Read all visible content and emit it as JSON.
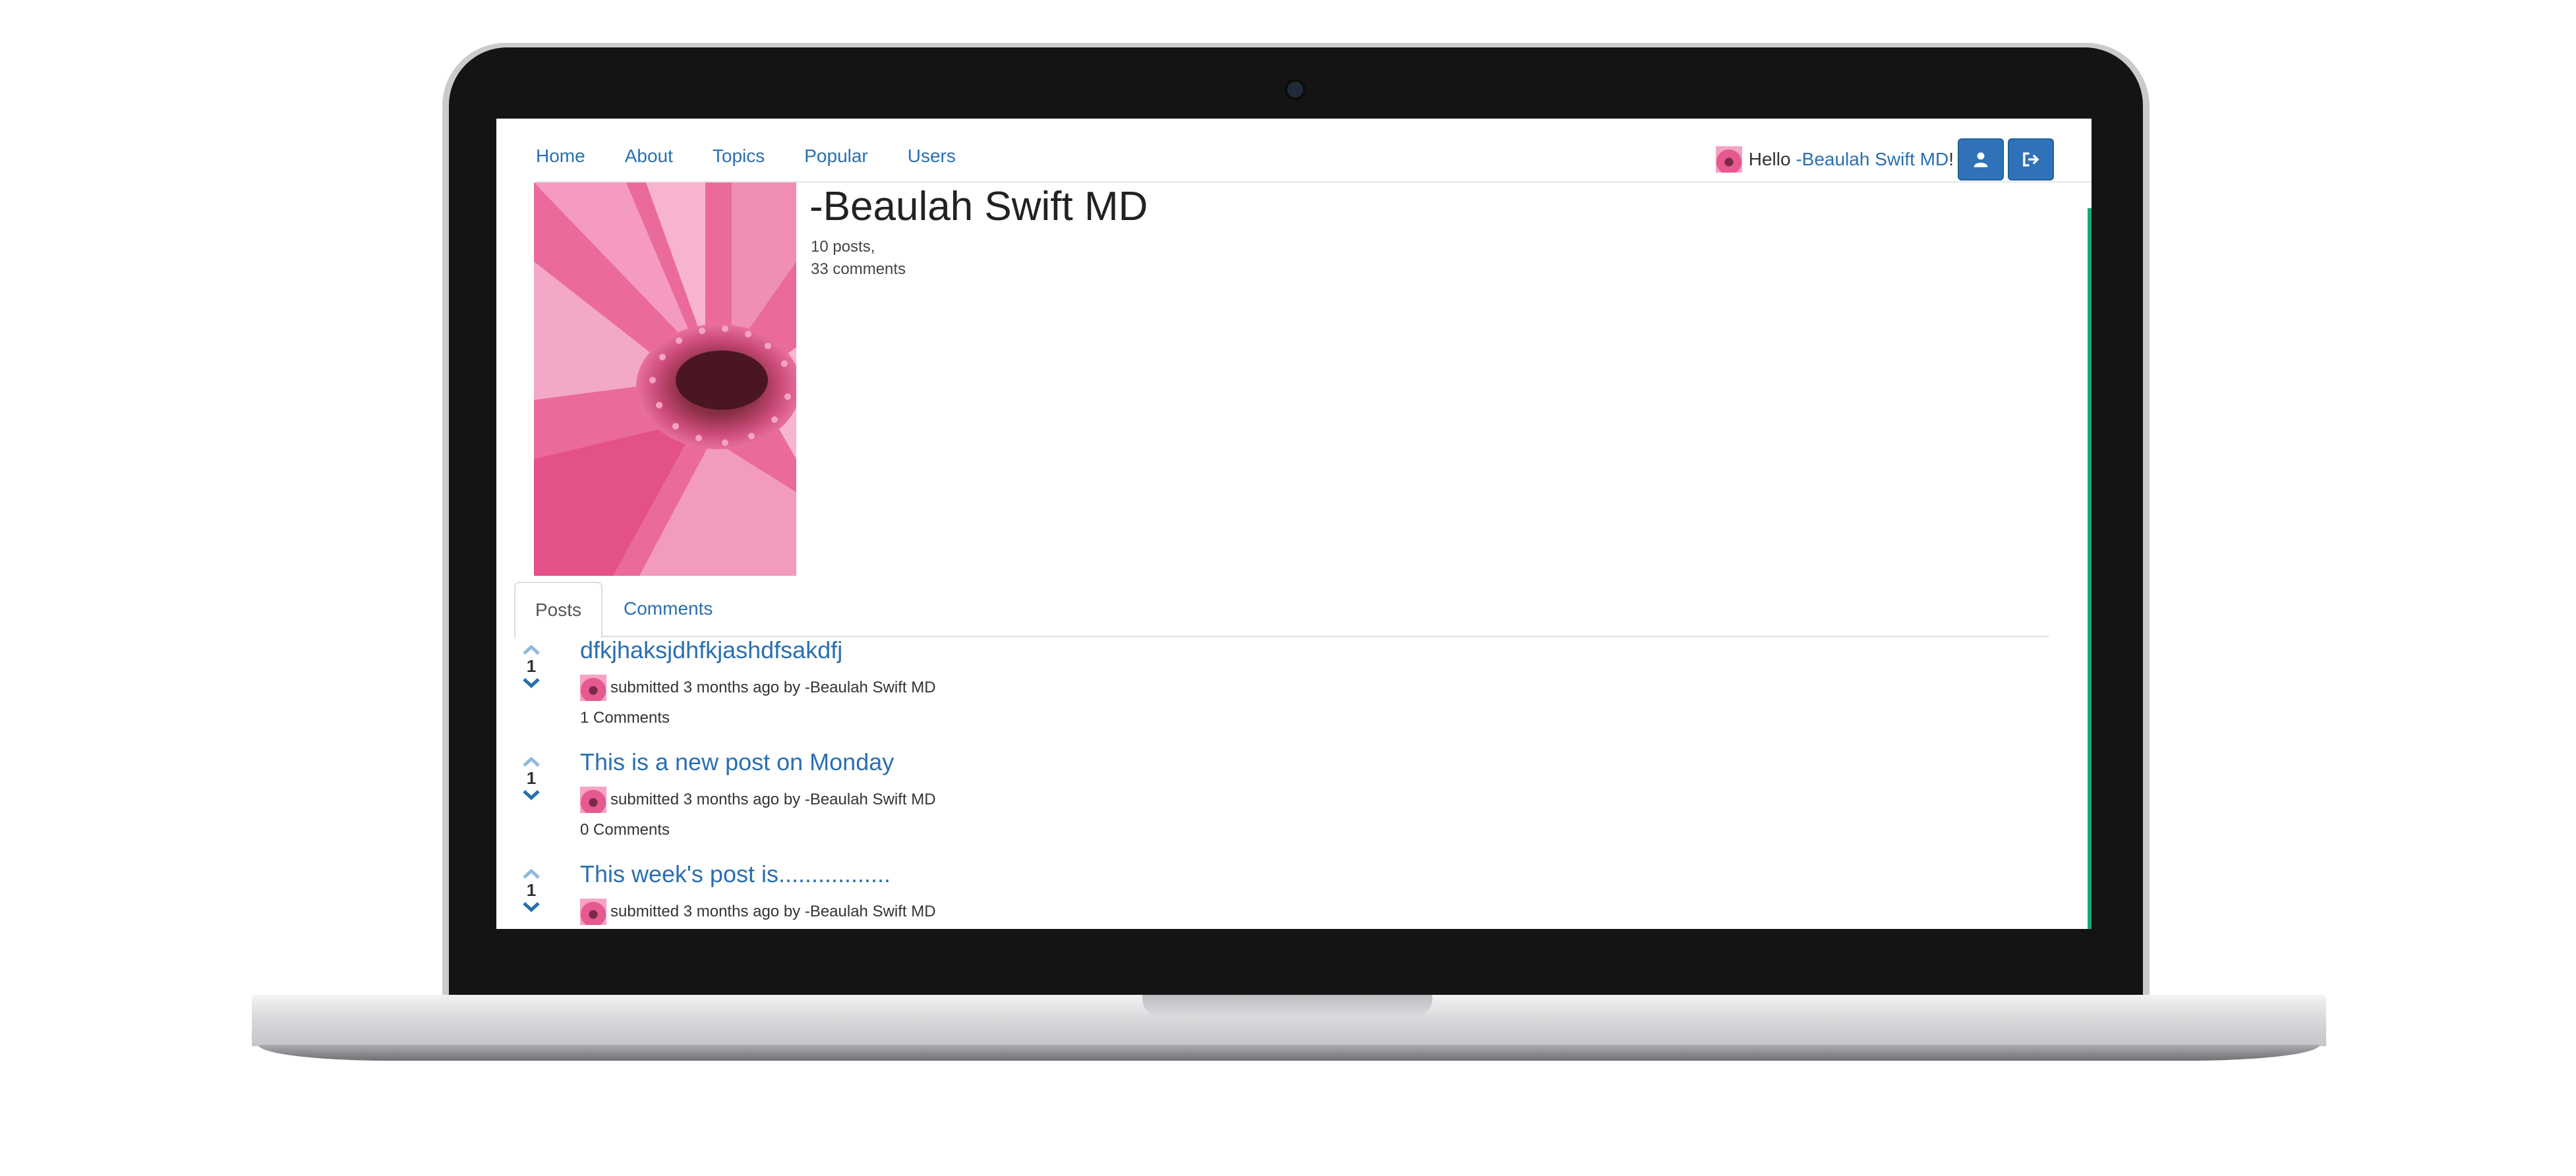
{
  "nav": {
    "items": [
      "Home",
      "About",
      "Topics",
      "Popular",
      "Users"
    ]
  },
  "header": {
    "hello_prefix": "Hello ",
    "username_link": "-Beaulah Swift MD",
    "hello_suffix": "!"
  },
  "profile": {
    "name": "-Beaulah Swift MD",
    "posts_stat": "10 posts,",
    "comments_stat": "33 comments"
  },
  "tabs": [
    "Posts",
    "Comments"
  ],
  "posts": [
    {
      "votes": "1",
      "title": "dfkjhaksjdhfkjashdfsakdfj",
      "meta": "submitted 3 months ago by -Beaulah Swift MD",
      "comments": "1 Comments"
    },
    {
      "votes": "1",
      "title": "This is a new post on Monday",
      "meta": "submitted 3 months ago by -Beaulah Swift MD",
      "comments": "0 Comments"
    },
    {
      "votes": "1",
      "title": "This week's post is.................",
      "meta": "submitted 3 months ago by -Beaulah Swift MD",
      "comments": ""
    }
  ],
  "colors": {
    "link": "#2a6fb0",
    "button": "#2f72b8",
    "accent": "#17a77c",
    "vote_arrow_up": "#8fb9de",
    "vote_arrow_down": "#2a6fb0"
  }
}
